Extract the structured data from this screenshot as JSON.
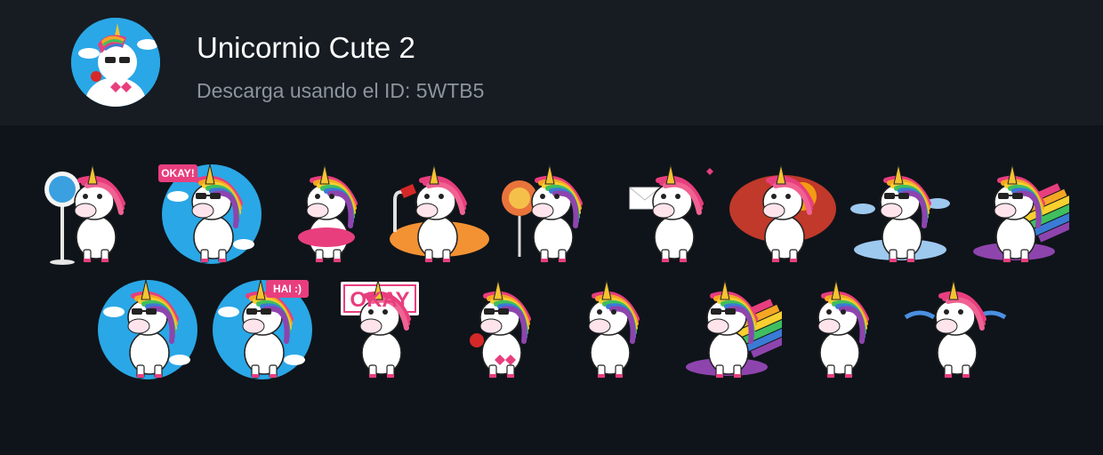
{
  "pack": {
    "title": "Unicornio Cute 2",
    "subtitle": "Descarga usando el ID: 5WTB5"
  },
  "colors": {
    "background": "#0f141a",
    "header": "#161c22",
    "title": "#ffffff",
    "subtitle": "#8d949b",
    "mane": "#e83e7e",
    "sky": "#2aa7e6"
  },
  "stickers": [
    {
      "name": "unicorn-bus-stop",
      "mane": "pink",
      "prop": "signpost",
      "text": ""
    },
    {
      "name": "unicorn-okay-bubble",
      "mane": "rainbow",
      "prop": "circle",
      "text": "OKAY!"
    },
    {
      "name": "unicorn-ballerina",
      "mane": "rainbow",
      "prop": "tutu",
      "text": ""
    },
    {
      "name": "unicorn-reading-lamp",
      "mane": "pink",
      "prop": "book",
      "text": ""
    },
    {
      "name": "unicorn-lollipop",
      "mane": "rainbow",
      "prop": "lollipop",
      "text": ""
    },
    {
      "name": "unicorn-love-letter",
      "mane": "pink",
      "prop": "letter",
      "text": ""
    },
    {
      "name": "unicorn-dice-sunset",
      "mane": "pink",
      "prop": "sunset",
      "text": ""
    },
    {
      "name": "unicorn-cloud-cool",
      "mane": "rainbow",
      "prop": "cloud",
      "text": ""
    },
    {
      "name": "unicorn-rainbow-surf",
      "mane": "rainbow",
      "prop": "surf",
      "text": ""
    },
    {
      "name": "unicorn-rose-circle",
      "mane": "rainbow",
      "prop": "circle",
      "text": ""
    },
    {
      "name": "unicorn-hai-wink",
      "mane": "rainbow",
      "prop": "circle",
      "text": "HAI :)"
    },
    {
      "name": "unicorn-okay-sign",
      "mane": "pink",
      "prop": "sign",
      "text": "OKAY"
    },
    {
      "name": "unicorn-rose-hearts",
      "mane": "rainbow",
      "prop": "rose",
      "text": ""
    },
    {
      "name": "unicorn-dab",
      "mane": "rainbow",
      "prop": "dab",
      "text": ""
    },
    {
      "name": "unicorn-surfboard",
      "mane": "rainbow",
      "prop": "surf",
      "text": ""
    },
    {
      "name": "unicorn-worried",
      "mane": "rainbow",
      "prop": "none",
      "text": ""
    },
    {
      "name": "unicorn-crying-laugh",
      "mane": "pink",
      "prop": "tears",
      "text": ""
    }
  ]
}
